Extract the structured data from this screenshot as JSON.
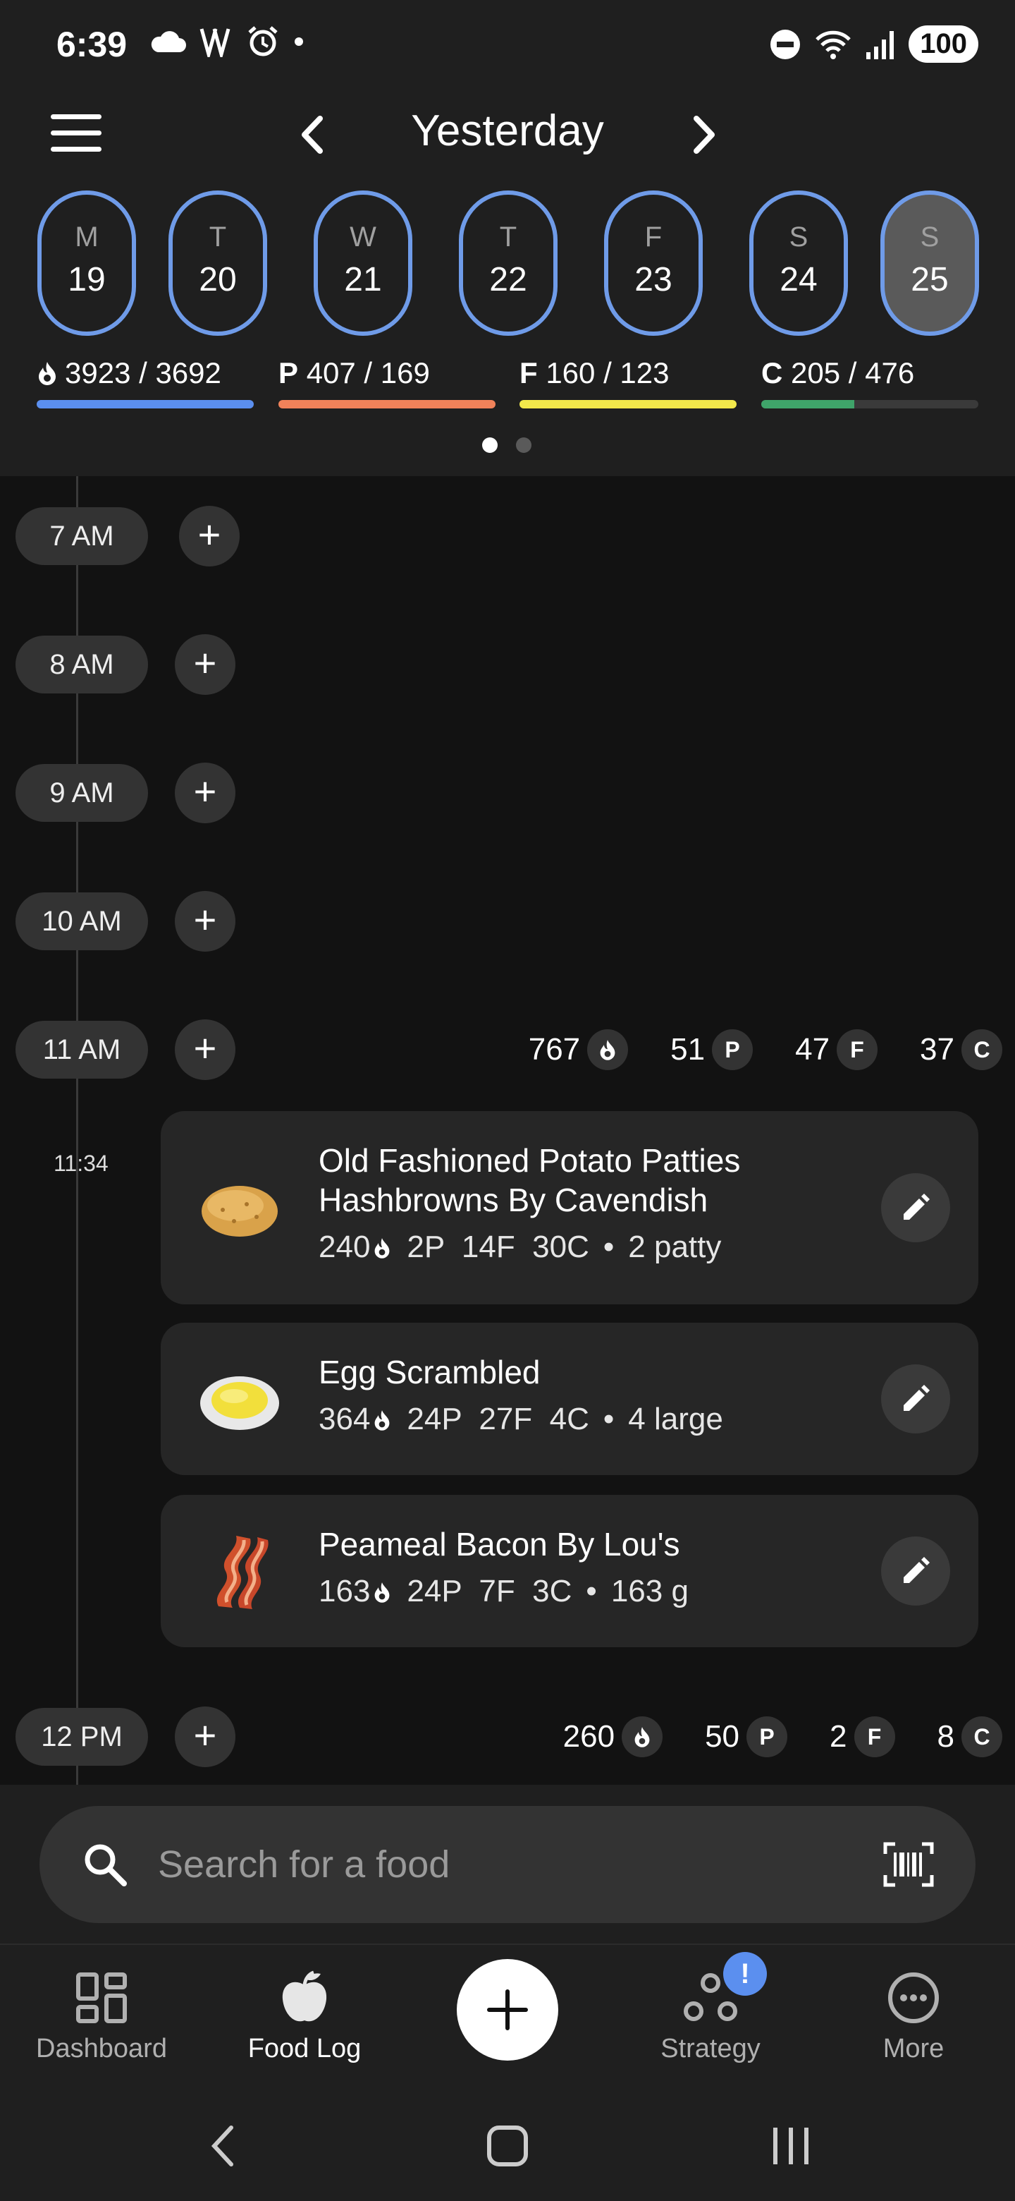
{
  "status_bar": {
    "time": "6:39",
    "battery": "100",
    "icons_left": [
      "cloud-icon",
      "wifi-calling-icon",
      "alarm-icon",
      "dot-icon"
    ],
    "icons_right": [
      "do-not-disturb-icon",
      "wifi-icon",
      "signal-icon"
    ]
  },
  "header": {
    "title": "Yesterday",
    "days": [
      {
        "letter": "M",
        "num": "19"
      },
      {
        "letter": "T",
        "num": "20"
      },
      {
        "letter": "W",
        "num": "21"
      },
      {
        "letter": "T",
        "num": "22"
      },
      {
        "letter": "F",
        "num": "23"
      },
      {
        "letter": "S",
        "num": "24"
      },
      {
        "letter": "S",
        "num": "25"
      }
    ],
    "selected_day_index": 6,
    "macros": [
      {
        "prefix": "",
        "value": "3923 / 3692",
        "color": "#5b8fef",
        "progress": 1.0
      },
      {
        "prefix": "P",
        "value": "407 / 169",
        "color": "#f0825a",
        "progress": 1.0
      },
      {
        "prefix": "F",
        "value": "160 / 123",
        "color": "#f2e84b",
        "progress": 1.0
      },
      {
        "prefix": "C",
        "value": "205 / 476",
        "color": "#3fa46a",
        "progress": 0.43
      }
    ],
    "page_dots": 2,
    "active_dot": 0
  },
  "timeline": {
    "hours": [
      {
        "label": "7 AM"
      },
      {
        "label": "8 AM"
      },
      {
        "label": "9 AM"
      },
      {
        "label": "10 AM"
      },
      {
        "label": "11 AM",
        "totals": {
          "cal": "767",
          "p": "51",
          "f": "47",
          "c": "37"
        }
      },
      {
        "label": "12 PM",
        "totals": {
          "cal": "260",
          "p": "50",
          "f": "2",
          "c": "8"
        }
      }
    ],
    "macro_badges": {
      "p": "P",
      "f": "F",
      "c": "C"
    },
    "meal_time": "11:34",
    "foods": [
      {
        "name_line1": "Old Fashioned Potato Patties",
        "name_line2": "Hashbrowns By Cavendish",
        "cal": "240",
        "macros": "2P  14F  30C",
        "serving": "2 patty",
        "icon": "potato-icon"
      },
      {
        "name_line1": "Egg Scrambled",
        "cal": "364",
        "macros": "24P  27F  4C",
        "serving": "4 large",
        "icon": "egg-icon"
      },
      {
        "name_line1": "Peameal Bacon By Lou's",
        "cal": "163",
        "macros": "24P  7F  3C",
        "serving": "163 g",
        "icon": "bacon-icon"
      }
    ]
  },
  "search": {
    "placeholder": "Search for a food"
  },
  "bottom_nav": {
    "items": [
      {
        "label": "Dashboard",
        "icon": "dashboard-icon"
      },
      {
        "label": "Food Log",
        "icon": "apple-icon"
      },
      {
        "label": "Strategy",
        "icon": "strategy-icon",
        "badge": "!"
      },
      {
        "label": "More",
        "icon": "more-icon"
      }
    ],
    "active": "Food Log"
  }
}
